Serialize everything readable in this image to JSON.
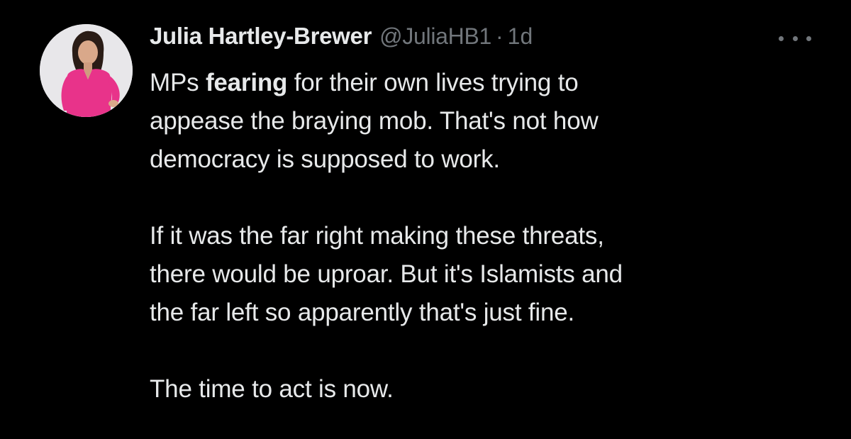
{
  "tweet": {
    "author": {
      "display_name": "Julia Hartley-Brewer",
      "handle": "@JuliaHB1",
      "separator": "·",
      "timestamp": "1d"
    },
    "more_icon": "more-horizontal-icon",
    "body": {
      "p1_lead": "MPs ",
      "p1_bold": "fearing",
      "p1_line1_rest": " for their own lives trying to",
      "p1_line2": "appease the braying mob. That's not how",
      "p1_line3": "democracy is supposed to work.",
      "p2_line1": "If it was the far right making these threats,",
      "p2_line2": "there would be uproar. But it's Islamists and",
      "p2_line3": "the far left so apparently that's just fine.",
      "p3_line1": "The time to act is now."
    }
  },
  "colors": {
    "background": "#000000",
    "primary_text": "#e7e9ea",
    "secondary_text": "#71767b",
    "avatar_dress": "#e8338a"
  }
}
